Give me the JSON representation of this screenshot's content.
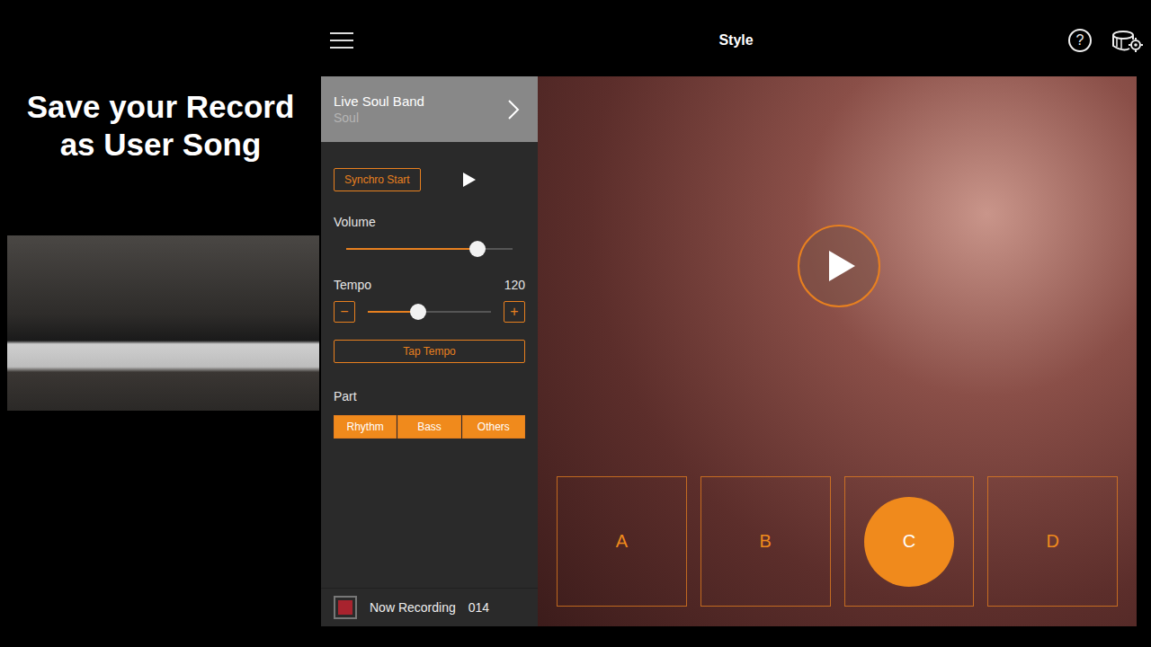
{
  "caption": {
    "lines": [
      "Save your Record",
      "as User Song"
    ]
  },
  "app": {
    "title": "Style",
    "help": "?"
  },
  "style": {
    "name": "Live Soul Band",
    "category": "Soul"
  },
  "synchro_start": {
    "label": "Synchro Start"
  },
  "volume": {
    "label": "Volume",
    "level": 0.79
  },
  "tempo": {
    "label": "Tempo",
    "value": "120",
    "level": 0.41,
    "minus": "−",
    "plus": "+"
  },
  "tap_tempo": {
    "label": "Tap Tempo"
  },
  "part": {
    "label": "Part",
    "items": [
      {
        "label": "Rhythm",
        "selected": true
      },
      {
        "label": "Bass",
        "selected": true
      },
      {
        "label": "Others",
        "selected": true
      }
    ]
  },
  "recording": {
    "label": "Now Recording",
    "counter": "014"
  },
  "sections": [
    {
      "label": "A",
      "selected": false
    },
    {
      "label": "B",
      "selected": false
    },
    {
      "label": "C",
      "selected": true
    },
    {
      "label": "D",
      "selected": false
    }
  ]
}
